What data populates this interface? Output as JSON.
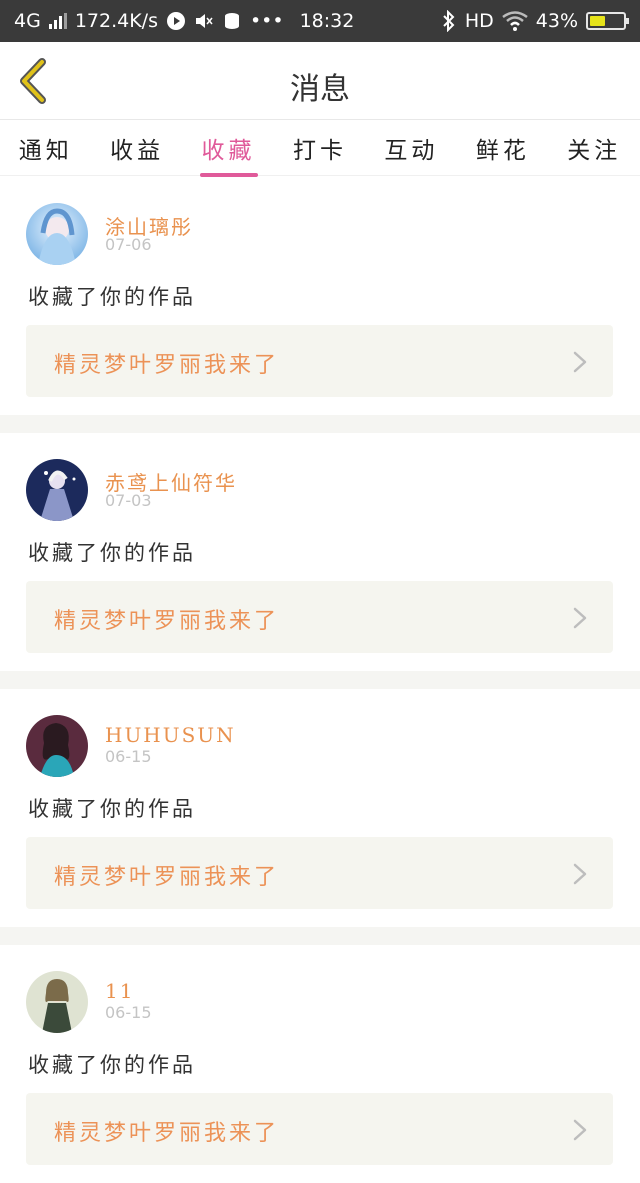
{
  "status_bar": {
    "network": "4G",
    "speed": "172.4K/s",
    "time": "18:32",
    "bluetooth_icon": "bluetooth-icon",
    "hd": "HD",
    "battery": "43%",
    "battery_level": 0.43
  },
  "nav": {
    "title": "消息",
    "back_icon": "chevron-left-icon"
  },
  "tabs": [
    {
      "label": "通知"
    },
    {
      "label": "收益"
    },
    {
      "label": "收藏",
      "active": true
    },
    {
      "label": "打卡"
    },
    {
      "label": "互动"
    },
    {
      "label": "鲜花"
    },
    {
      "label": "关注"
    }
  ],
  "colors": {
    "accent_tab": "#e05a9a",
    "username": "#e9924f",
    "work_title": "#ec9257",
    "back_arrow": "#e0c21a"
  },
  "notifications": [
    {
      "user": "涂山璃彤",
      "date": "07-06",
      "action": "收藏了你的作品",
      "work": "精灵梦叶罗丽我来了"
    },
    {
      "user": "赤鸢上仙符华",
      "date": "07-03",
      "action": "收藏了你的作品",
      "work": "精灵梦叶罗丽我来了"
    },
    {
      "user": "HUHUSUN",
      "date": "06-15",
      "action": "收藏了你的作品",
      "work": "精灵梦叶罗丽我来了"
    },
    {
      "user": "11",
      "date": "06-15",
      "action": "收藏了你的作品",
      "work": "精灵梦叶罗丽我来了"
    }
  ]
}
